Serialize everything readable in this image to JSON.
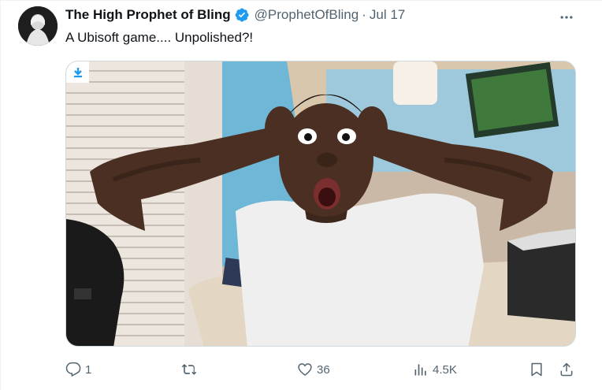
{
  "author": {
    "display_name": "The High Prophet of Bling",
    "handle": "@ProphetOfBling",
    "separator": "·",
    "date": "Jul 17"
  },
  "tweet": {
    "text": "A Ubisoft game.... Unpolished?!"
  },
  "icons": {
    "verified": "verified-badge-icon",
    "more": "more-options-icon",
    "download": "download-icon",
    "reply": "reply-icon",
    "retweet": "retweet-icon",
    "like": "like-icon",
    "views": "views-icon",
    "bookmark": "bookmark-icon",
    "share": "share-icon"
  },
  "actions": {
    "replies": "1",
    "retweets": "",
    "likes": "36",
    "views": "4.5K"
  },
  "colors": {
    "verified": "#1d9bf0",
    "secondary_text": "#536471",
    "primary_text": "#0f1419"
  }
}
